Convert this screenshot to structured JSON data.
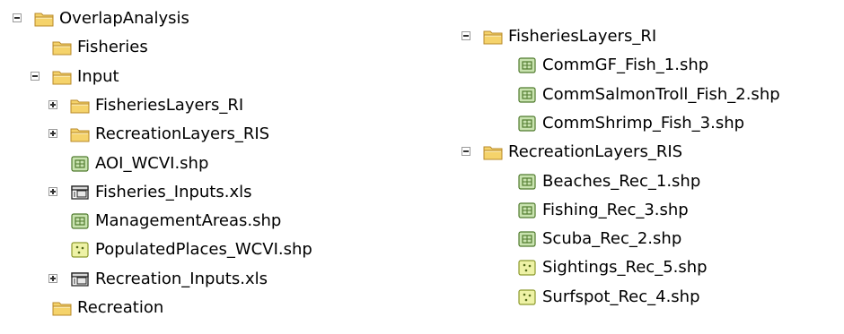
{
  "left_tree": [
    {
      "label": "OverlapAnalysis",
      "icon": "folder-icon",
      "toggle": "minus",
      "indent": 0
    },
    {
      "label": "Fisheries",
      "icon": "folder-icon",
      "toggle": "none",
      "indent": 1
    },
    {
      "label": "Input",
      "icon": "folder-icon",
      "toggle": "minus",
      "indent": 1
    },
    {
      "label": "FisheriesLayers_RI",
      "icon": "folder-icon",
      "toggle": "plus",
      "indent": 2
    },
    {
      "label": "RecreationLayers_RIS",
      "icon": "folder-icon",
      "toggle": "plus",
      "indent": 2
    },
    {
      "label": "AOI_WCVI.shp",
      "icon": "polygon-layer-icon",
      "toggle": "none",
      "indent": 2
    },
    {
      "label": "Fisheries_Inputs.xls",
      "icon": "table-icon",
      "toggle": "plus",
      "indent": 2
    },
    {
      "label": "ManagementAreas.shp",
      "icon": "polygon-layer-icon",
      "toggle": "none",
      "indent": 2
    },
    {
      "label": "PopulatedPlaces_WCVI.shp",
      "icon": "point-layer-icon",
      "toggle": "none",
      "indent": 2
    },
    {
      "label": "Recreation_Inputs.xls",
      "icon": "table-icon",
      "toggle": "plus",
      "indent": 2
    },
    {
      "label": "Recreation",
      "icon": "folder-icon",
      "toggle": "none",
      "indent": 1
    }
  ],
  "right_tree": [
    {
      "label": "FisheriesLayers_RI",
      "icon": "folder-icon",
      "toggle": "minus",
      "indent": 0
    },
    {
      "label": "CommGF_Fish_1.shp",
      "icon": "polygon-layer-icon",
      "toggle": "none",
      "indent": 1
    },
    {
      "label": "CommSalmonTroll_Fish_2.shp",
      "icon": "polygon-layer-icon",
      "toggle": "none",
      "indent": 1
    },
    {
      "label": "CommShrimp_Fish_3.shp",
      "icon": "polygon-layer-icon",
      "toggle": "none",
      "indent": 1
    },
    {
      "label": "RecreationLayers_RIS",
      "icon": "folder-icon",
      "toggle": "minus",
      "indent": 0
    },
    {
      "label": "Beaches_Rec_1.shp",
      "icon": "polygon-layer-icon",
      "toggle": "none",
      "indent": 1
    },
    {
      "label": "Fishing_Rec_3.shp",
      "icon": "polygon-layer-icon",
      "toggle": "none",
      "indent": 1
    },
    {
      "label": "Scuba_Rec_2.shp",
      "icon": "polygon-layer-icon",
      "toggle": "none",
      "indent": 1
    },
    {
      "label": "Sightings_Rec_5.shp",
      "icon": "point-layer-icon",
      "toggle": "none",
      "indent": 1
    },
    {
      "label": "Surfspot_Rec_4.shp",
      "icon": "point-layer-icon",
      "toggle": "none",
      "indent": 1
    }
  ],
  "colors": {
    "folder_body": "#f5d36b",
    "folder_edge": "#b8892a",
    "polygon_fill": "#c9e3b0",
    "polygon_edge": "#4f7a2d",
    "point_fill": "#eef2a6",
    "point_edge": "#8c9a2c",
    "table_edge": "#222222"
  }
}
